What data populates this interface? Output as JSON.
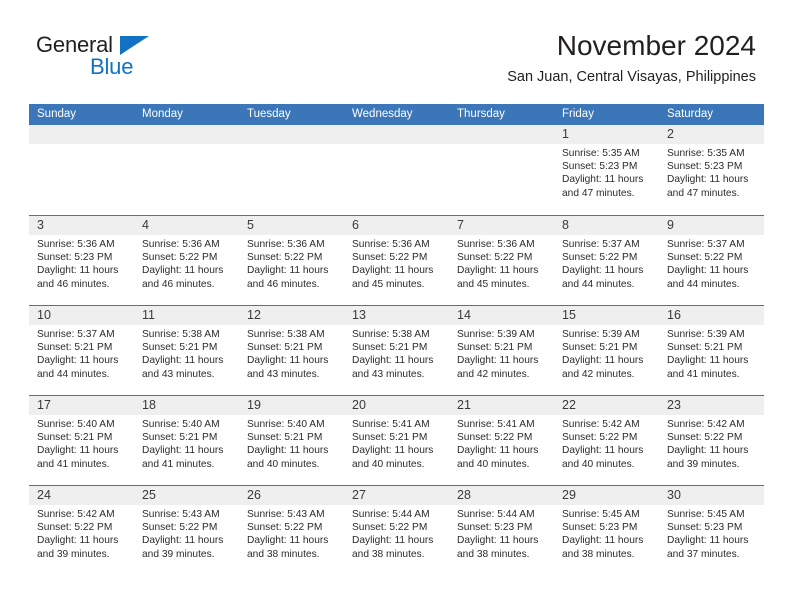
{
  "logo": {
    "word1": "General",
    "word2": "Blue",
    "triangle_color": "#1273c4",
    "text_color": "#231f20"
  },
  "header": {
    "month_title": "November 2024",
    "location": "San Juan, Central Visayas, Philippines"
  },
  "theme": {
    "header_blue": "#3a76b8",
    "day_band_gray": "#efefef",
    "row_divider": "#3a76b8",
    "body_text": "#2b2b2b"
  },
  "weekday_headers": [
    "Sunday",
    "Monday",
    "Tuesday",
    "Wednesday",
    "Thursday",
    "Friday",
    "Saturday"
  ],
  "labels": {
    "sunrise_prefix": "Sunrise:",
    "sunset_prefix": "Sunset:",
    "daylight_prefix": "Daylight:"
  },
  "weeks": [
    [
      {
        "day": "",
        "empty": true
      },
      {
        "day": "",
        "empty": true
      },
      {
        "day": "",
        "empty": true
      },
      {
        "day": "",
        "empty": true
      },
      {
        "day": "",
        "empty": true
      },
      {
        "day": "1",
        "sunrise": "Sunrise: 5:35 AM",
        "sunset": "Sunset: 5:23 PM",
        "daylight1": "Daylight: 11 hours",
        "daylight2": "and 47 minutes."
      },
      {
        "day": "2",
        "sunrise": "Sunrise: 5:35 AM",
        "sunset": "Sunset: 5:23 PM",
        "daylight1": "Daylight: 11 hours",
        "daylight2": "and 47 minutes."
      }
    ],
    [
      {
        "day": "3",
        "sunrise": "Sunrise: 5:36 AM",
        "sunset": "Sunset: 5:23 PM",
        "daylight1": "Daylight: 11 hours",
        "daylight2": "and 46 minutes."
      },
      {
        "day": "4",
        "sunrise": "Sunrise: 5:36 AM",
        "sunset": "Sunset: 5:22 PM",
        "daylight1": "Daylight: 11 hours",
        "daylight2": "and 46 minutes."
      },
      {
        "day": "5",
        "sunrise": "Sunrise: 5:36 AM",
        "sunset": "Sunset: 5:22 PM",
        "daylight1": "Daylight: 11 hours",
        "daylight2": "and 46 minutes."
      },
      {
        "day": "6",
        "sunrise": "Sunrise: 5:36 AM",
        "sunset": "Sunset: 5:22 PM",
        "daylight1": "Daylight: 11 hours",
        "daylight2": "and 45 minutes."
      },
      {
        "day": "7",
        "sunrise": "Sunrise: 5:36 AM",
        "sunset": "Sunset: 5:22 PM",
        "daylight1": "Daylight: 11 hours",
        "daylight2": "and 45 minutes."
      },
      {
        "day": "8",
        "sunrise": "Sunrise: 5:37 AM",
        "sunset": "Sunset: 5:22 PM",
        "daylight1": "Daylight: 11 hours",
        "daylight2": "and 44 minutes."
      },
      {
        "day": "9",
        "sunrise": "Sunrise: 5:37 AM",
        "sunset": "Sunset: 5:22 PM",
        "daylight1": "Daylight: 11 hours",
        "daylight2": "and 44 minutes."
      }
    ],
    [
      {
        "day": "10",
        "sunrise": "Sunrise: 5:37 AM",
        "sunset": "Sunset: 5:21 PM",
        "daylight1": "Daylight: 11 hours",
        "daylight2": "and 44 minutes."
      },
      {
        "day": "11",
        "sunrise": "Sunrise: 5:38 AM",
        "sunset": "Sunset: 5:21 PM",
        "daylight1": "Daylight: 11 hours",
        "daylight2": "and 43 minutes."
      },
      {
        "day": "12",
        "sunrise": "Sunrise: 5:38 AM",
        "sunset": "Sunset: 5:21 PM",
        "daylight1": "Daylight: 11 hours",
        "daylight2": "and 43 minutes."
      },
      {
        "day": "13",
        "sunrise": "Sunrise: 5:38 AM",
        "sunset": "Sunset: 5:21 PM",
        "daylight1": "Daylight: 11 hours",
        "daylight2": "and 43 minutes."
      },
      {
        "day": "14",
        "sunrise": "Sunrise: 5:39 AM",
        "sunset": "Sunset: 5:21 PM",
        "daylight1": "Daylight: 11 hours",
        "daylight2": "and 42 minutes."
      },
      {
        "day": "15",
        "sunrise": "Sunrise: 5:39 AM",
        "sunset": "Sunset: 5:21 PM",
        "daylight1": "Daylight: 11 hours",
        "daylight2": "and 42 minutes."
      },
      {
        "day": "16",
        "sunrise": "Sunrise: 5:39 AM",
        "sunset": "Sunset: 5:21 PM",
        "daylight1": "Daylight: 11 hours",
        "daylight2": "and 41 minutes."
      }
    ],
    [
      {
        "day": "17",
        "sunrise": "Sunrise: 5:40 AM",
        "sunset": "Sunset: 5:21 PM",
        "daylight1": "Daylight: 11 hours",
        "daylight2": "and 41 minutes."
      },
      {
        "day": "18",
        "sunrise": "Sunrise: 5:40 AM",
        "sunset": "Sunset: 5:21 PM",
        "daylight1": "Daylight: 11 hours",
        "daylight2": "and 41 minutes."
      },
      {
        "day": "19",
        "sunrise": "Sunrise: 5:40 AM",
        "sunset": "Sunset: 5:21 PM",
        "daylight1": "Daylight: 11 hours",
        "daylight2": "and 40 minutes."
      },
      {
        "day": "20",
        "sunrise": "Sunrise: 5:41 AM",
        "sunset": "Sunset: 5:21 PM",
        "daylight1": "Daylight: 11 hours",
        "daylight2": "and 40 minutes."
      },
      {
        "day": "21",
        "sunrise": "Sunrise: 5:41 AM",
        "sunset": "Sunset: 5:22 PM",
        "daylight1": "Daylight: 11 hours",
        "daylight2": "and 40 minutes."
      },
      {
        "day": "22",
        "sunrise": "Sunrise: 5:42 AM",
        "sunset": "Sunset: 5:22 PM",
        "daylight1": "Daylight: 11 hours",
        "daylight2": "and 40 minutes."
      },
      {
        "day": "23",
        "sunrise": "Sunrise: 5:42 AM",
        "sunset": "Sunset: 5:22 PM",
        "daylight1": "Daylight: 11 hours",
        "daylight2": "and 39 minutes."
      }
    ],
    [
      {
        "day": "24",
        "sunrise": "Sunrise: 5:42 AM",
        "sunset": "Sunset: 5:22 PM",
        "daylight1": "Daylight: 11 hours",
        "daylight2": "and 39 minutes."
      },
      {
        "day": "25",
        "sunrise": "Sunrise: 5:43 AM",
        "sunset": "Sunset: 5:22 PM",
        "daylight1": "Daylight: 11 hours",
        "daylight2": "and 39 minutes."
      },
      {
        "day": "26",
        "sunrise": "Sunrise: 5:43 AM",
        "sunset": "Sunset: 5:22 PM",
        "daylight1": "Daylight: 11 hours",
        "daylight2": "and 38 minutes."
      },
      {
        "day": "27",
        "sunrise": "Sunrise: 5:44 AM",
        "sunset": "Sunset: 5:22 PM",
        "daylight1": "Daylight: 11 hours",
        "daylight2": "and 38 minutes."
      },
      {
        "day": "28",
        "sunrise": "Sunrise: 5:44 AM",
        "sunset": "Sunset: 5:23 PM",
        "daylight1": "Daylight: 11 hours",
        "daylight2": "and 38 minutes."
      },
      {
        "day": "29",
        "sunrise": "Sunrise: 5:45 AM",
        "sunset": "Sunset: 5:23 PM",
        "daylight1": "Daylight: 11 hours",
        "daylight2": "and 38 minutes."
      },
      {
        "day": "30",
        "sunrise": "Sunrise: 5:45 AM",
        "sunset": "Sunset: 5:23 PM",
        "daylight1": "Daylight: 11 hours",
        "daylight2": "and 37 minutes."
      }
    ]
  ]
}
